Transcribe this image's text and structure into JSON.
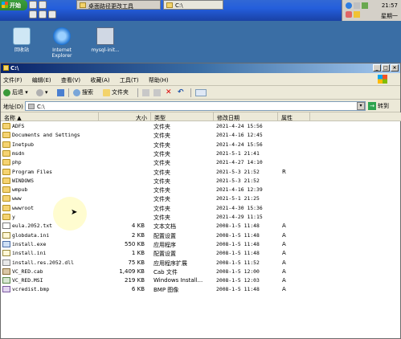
{
  "taskbar": {
    "start_label": "开始",
    "tasks": [
      {
        "label": "桌面路径更改工具",
        "icon": "tool-icon"
      },
      {
        "label": "C:\\",
        "icon": "folder-icon"
      }
    ],
    "clock": "21:57",
    "day": "星期一"
  },
  "desktop": {
    "icons": [
      {
        "label": "回收站",
        "icon": "recycle-bin-icon"
      },
      {
        "label": "Internet Explorer",
        "icon": "ie-icon"
      },
      {
        "label": "mysql-init...",
        "icon": "install-icon"
      }
    ]
  },
  "window": {
    "title": "C:\\",
    "menu": [
      "文件(F)",
      "编辑(E)",
      "查看(V)",
      "收藏(A)",
      "工具(T)",
      "帮助(H)"
    ],
    "toolbar": {
      "back": "后退",
      "search": "搜索",
      "folders": "文件夹"
    },
    "address": {
      "label": "地址(D)",
      "value": "C:\\",
      "go": "转到"
    },
    "columns": [
      "名称 ▲",
      "大小",
      "类型",
      "修改日期",
      "属性"
    ],
    "files": [
      {
        "name": "ADFS",
        "size": "",
        "type": "文件夹",
        "date": "2021-4-24 15:56",
        "attr": "",
        "kind": "folder"
      },
      {
        "name": "Documents and Settings",
        "size": "",
        "type": "文件夹",
        "date": "2021-4-16 12:45",
        "attr": "",
        "kind": "folder"
      },
      {
        "name": "Inetpub",
        "size": "",
        "type": "文件夹",
        "date": "2021-4-24 15:56",
        "attr": "",
        "kind": "folder"
      },
      {
        "name": "msdn",
        "size": "",
        "type": "文件夹",
        "date": "2021-5-1 21:41",
        "attr": "",
        "kind": "folder"
      },
      {
        "name": "php",
        "size": "",
        "type": "文件夹",
        "date": "2021-4-27 14:10",
        "attr": "",
        "kind": "folder"
      },
      {
        "name": "Program Files",
        "size": "",
        "type": "文件夹",
        "date": "2021-5-3 21:52",
        "attr": "R",
        "kind": "folder"
      },
      {
        "name": "WINDOWS",
        "size": "",
        "type": "文件夹",
        "date": "2021-5-3 21:52",
        "attr": "",
        "kind": "folder"
      },
      {
        "name": "wmpub",
        "size": "",
        "type": "文件夹",
        "date": "2021-4-16 12:39",
        "attr": "",
        "kind": "folder"
      },
      {
        "name": "www",
        "size": "",
        "type": "文件夹",
        "date": "2021-5-1 21:25",
        "attr": "",
        "kind": "folder"
      },
      {
        "name": "wwwroot",
        "size": "",
        "type": "文件夹",
        "date": "2021-4-30 15:36",
        "attr": "",
        "kind": "folder"
      },
      {
        "name": "y",
        "size": "",
        "type": "文件夹",
        "date": "2021-4-29 11:15",
        "attr": "",
        "kind": "folder"
      },
      {
        "name": "eula.2052.txt",
        "size": "4 KB",
        "type": "文本文档",
        "date": "2008-1-5 11:48",
        "attr": "A",
        "kind": "doc"
      },
      {
        "name": "globdata.ini",
        "size": "2 KB",
        "type": "配置设置",
        "date": "2008-1-5 11:48",
        "attr": "A",
        "kind": "ini"
      },
      {
        "name": "install.exe",
        "size": "550 KB",
        "type": "应用程序",
        "date": "2008-1-5 11:48",
        "attr": "A",
        "kind": "exe"
      },
      {
        "name": "install.ini",
        "size": "1 KB",
        "type": "配置设置",
        "date": "2008-1-5 11:48",
        "attr": "A",
        "kind": "ini"
      },
      {
        "name": "install.res.2052.dll",
        "size": "75 KB",
        "type": "应用程序扩展",
        "date": "2008-1-5 11:52",
        "attr": "A",
        "kind": "dll"
      },
      {
        "name": "VC_RED.cab",
        "size": "1,409 KB",
        "type": "Cab 文件",
        "date": "2008-1-5 12:00",
        "attr": "A",
        "kind": "cab"
      },
      {
        "name": "VC_RED.MSI",
        "size": "219 KB",
        "type": "Windows Install...",
        "date": "2008-1-5 12:03",
        "attr": "A",
        "kind": "msi"
      },
      {
        "name": "vcredist.bmp",
        "size": "6 KB",
        "type": "BMP 图像",
        "date": "2008-1-5 11:48",
        "attr": "A",
        "kind": "bmp"
      }
    ]
  }
}
